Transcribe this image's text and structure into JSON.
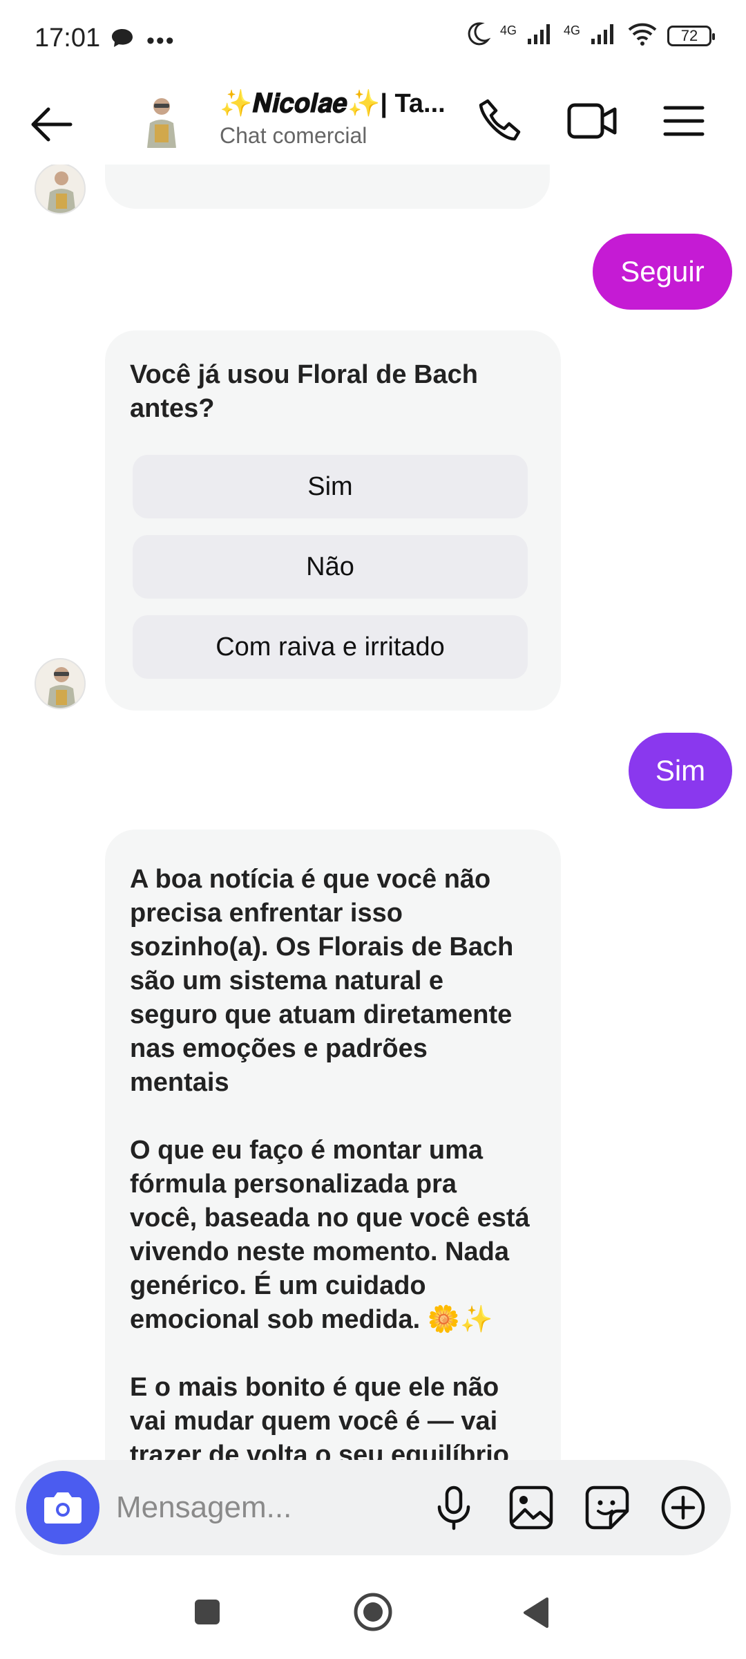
{
  "status_bar": {
    "time": "17:01",
    "network_1": "4G",
    "network_2": "4G",
    "battery": "72"
  },
  "header": {
    "title": "✨𝑵𝒊𝒄𝒐𝒍𝒂𝒆✨| Ta...",
    "subtitle": "Chat comercial"
  },
  "messages": {
    "sent_1": "Seguir",
    "question": "Você já usou Floral de Bach antes?",
    "options": [
      "Sim",
      "Não",
      "Com raiva e irritado"
    ],
    "sent_2": "Sim",
    "long_paragraph_1": "A boa notícia é que você não precisa enfrentar isso sozinho(a). Os Florais de Bach são um sistema natural e seguro que atuam diretamente nas emoções e padrões mentais",
    "long_paragraph_2": "O que eu faço é montar uma fórmula personalizada pra você, baseada no que você está vivendo neste momento. Nada genérico. É um cuidado emocional sob medida. 🌼✨",
    "long_paragraph_3": "E o mais bonito é que ele não vai mudar quem você é — vai trazer de volta o seu equilíbrio"
  },
  "composer": {
    "placeholder": "Mensagem..."
  },
  "colors": {
    "sent_bubble_1": "#c51bd4",
    "sent_bubble_2": "#8a38ee",
    "camera_button": "#4b5cf0",
    "received_bubble": "#f5f6f6"
  }
}
